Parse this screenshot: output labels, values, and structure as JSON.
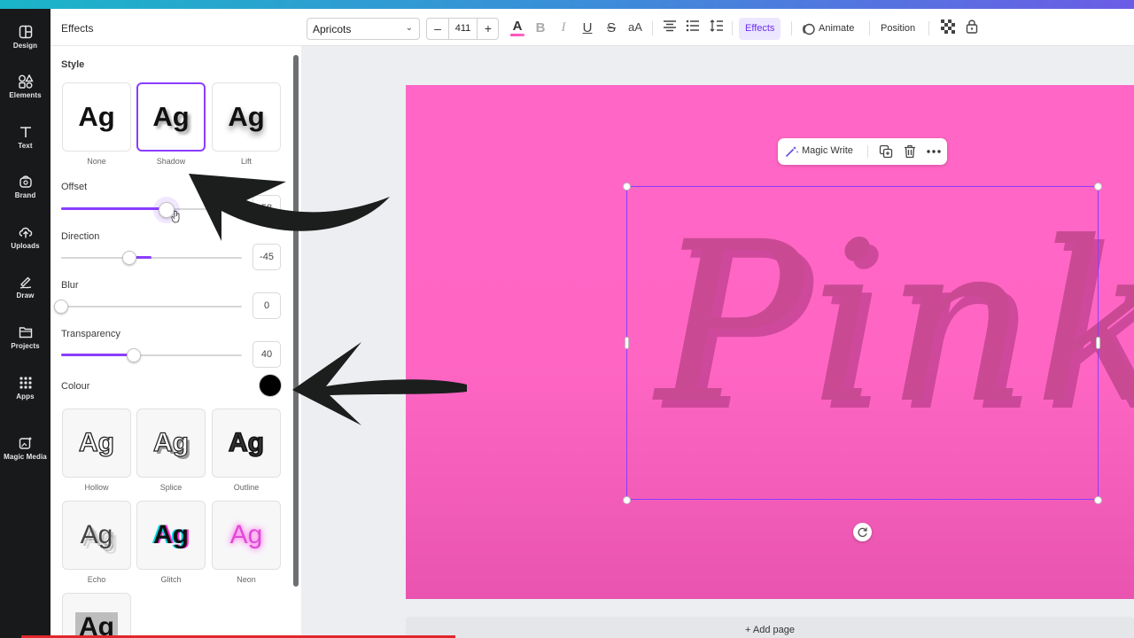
{
  "rail": {
    "items": [
      {
        "label": "Design",
        "icon": "design-icon"
      },
      {
        "label": "Elements",
        "icon": "elements-icon"
      },
      {
        "label": "Text",
        "icon": "text-icon"
      },
      {
        "label": "Brand",
        "icon": "brand-icon"
      },
      {
        "label": "Uploads",
        "icon": "uploads-icon"
      },
      {
        "label": "Draw",
        "icon": "draw-icon"
      },
      {
        "label": "Projects",
        "icon": "projects-icon"
      },
      {
        "label": "Apps",
        "icon": "apps-icon"
      },
      {
        "label": "Magic Media",
        "icon": "magic-media-icon"
      }
    ]
  },
  "panel": {
    "title": "Effects",
    "style_label": "Style",
    "style_cards": [
      {
        "sample": "Ag",
        "caption": "None"
      },
      {
        "sample": "Ag",
        "caption": "Shadow",
        "selected": true
      },
      {
        "sample": "Ag",
        "caption": "Lift"
      }
    ],
    "sliders": {
      "offset": {
        "label": "Offset",
        "value": "58",
        "level": 58
      },
      "direction": {
        "label": "Direction",
        "value": "-45",
        "level": -45
      },
      "blur": {
        "label": "Blur",
        "value": "0",
        "level": 0
      },
      "transparency": {
        "label": "Transparency",
        "value": "40",
        "level": 40
      }
    },
    "colour_label": "Colour",
    "colour_value": "#000000",
    "effect_cards": [
      {
        "sample": "Ag",
        "caption": "Hollow"
      },
      {
        "sample": "Ag",
        "caption": "Splice"
      },
      {
        "sample": "Ag",
        "caption": "Outline"
      },
      {
        "sample": "Ag",
        "caption": "Echo"
      },
      {
        "sample": "Ag",
        "caption": "Glitch"
      },
      {
        "sample": "Ag",
        "caption": "Neon"
      },
      {
        "sample": "Ag",
        "caption": ""
      }
    ]
  },
  "toolbar": {
    "font_name": "Apricots",
    "minus": "–",
    "font_size": "411",
    "plus": "+",
    "text_color_glyph": "A",
    "bold_glyph": "B",
    "italic_glyph": "I",
    "underline_glyph": "U",
    "strike_glyph": "S",
    "case_glyph": "aA",
    "effects_label": "Effects",
    "animate_label": "Animate",
    "position_label": "Position",
    "accent_color": "#8b3dff"
  },
  "canvas": {
    "page_text": "Pink",
    "page_color": "#ff66c6",
    "magic_write_label": "Magic Write",
    "add_page_label": "+ Add page"
  }
}
